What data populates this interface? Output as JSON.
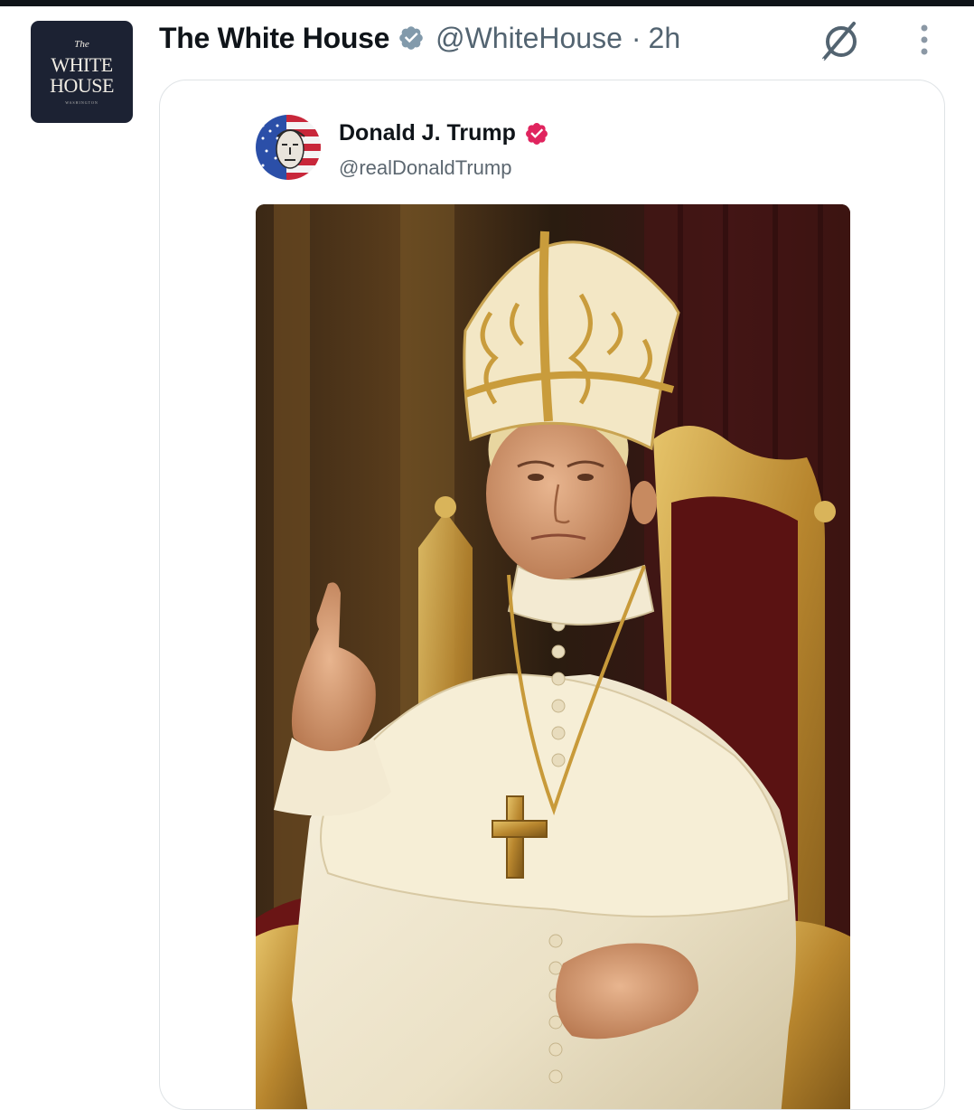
{
  "post": {
    "author_name": "The White House",
    "author_handle": "@WhiteHouse",
    "separator": "·",
    "time": "2h",
    "avatar": {
      "line1": "The",
      "line2": "WHITE",
      "line3": "HOUSE",
      "line4": "WASHINGTON",
      "bg_color": "#1c2233"
    },
    "icons": {
      "verified": "verified-badge-icon",
      "grok": "grok-icon",
      "more": "more-vertical-icon"
    }
  },
  "quoted_post": {
    "author_name": "Donald J. Trump",
    "author_handle": "@realDonaldTrump",
    "badge_color": "#e0245e",
    "avatar_icon": "flag-portrait-avatar",
    "image_alt": "AI-generated image of Donald Trump dressed as the Pope seated on a gilded throne"
  },
  "colors": {
    "text_primary": "#0f1419",
    "text_secondary": "#536471",
    "card_border": "#dfe3e6",
    "verified_gray": "#829aab"
  }
}
